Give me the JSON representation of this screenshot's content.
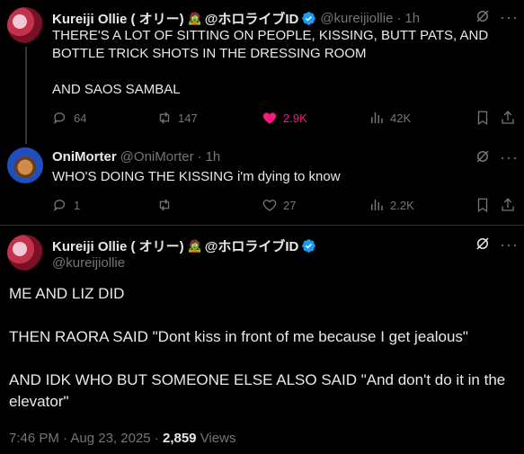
{
  "tweet1": {
    "display_name": "Kureiji Ollie ( オリー)",
    "emoji": "🧟",
    "name_suffix": "@ホロライブID",
    "handle": "@kureijiollie",
    "time": "1h",
    "text_line1": "THERE'S A LOT OF SITTING ON PEOPLE, KISSING, BUTT PATS, AND",
    "text_line2": "BOTTLE TRICK SHOTS IN THE DRESSING ROOM",
    "text_line3": "AND SAOS SAMBAL",
    "replies": "64",
    "reposts": "147",
    "likes": "2.9K",
    "views": "42K"
  },
  "tweet2": {
    "display_name": "OniMorter",
    "handle": "@OniMorter",
    "time": "1h",
    "text": "WHO'S DOING THE KISSING i'm dying to know",
    "replies": "1",
    "reposts": "",
    "likes": "27",
    "views": "2.2K"
  },
  "tweet3": {
    "display_name": "Kureiji Ollie ( オリー)",
    "emoji": "🧟",
    "name_suffix": "@ホロライブID",
    "handle": "@kureijiollie",
    "para1": "ME AND LIZ DID",
    "para2": "THEN RAORA SAID \"Dont kiss in front of me because I get jealous\"",
    "para3": "AND IDK WHO BUT SOMEONE ELSE ALSO SAID \"And don't do it in the elevator\"",
    "time": "7:46 PM",
    "date": "Aug 23, 2025",
    "sep": "·",
    "views_count": "2,859",
    "views_label": "Views"
  },
  "icons": [
    "grok-icon",
    "more-icon",
    "reply-icon",
    "repost-icon",
    "like-icon",
    "views-icon",
    "bookmark-icon",
    "share-icon",
    "verified-icon"
  ],
  "colors": {
    "background": "#000000",
    "text": "#e7e9ea",
    "muted": "#71767b",
    "like": "#f91880",
    "verified": "#1d9bf0"
  }
}
